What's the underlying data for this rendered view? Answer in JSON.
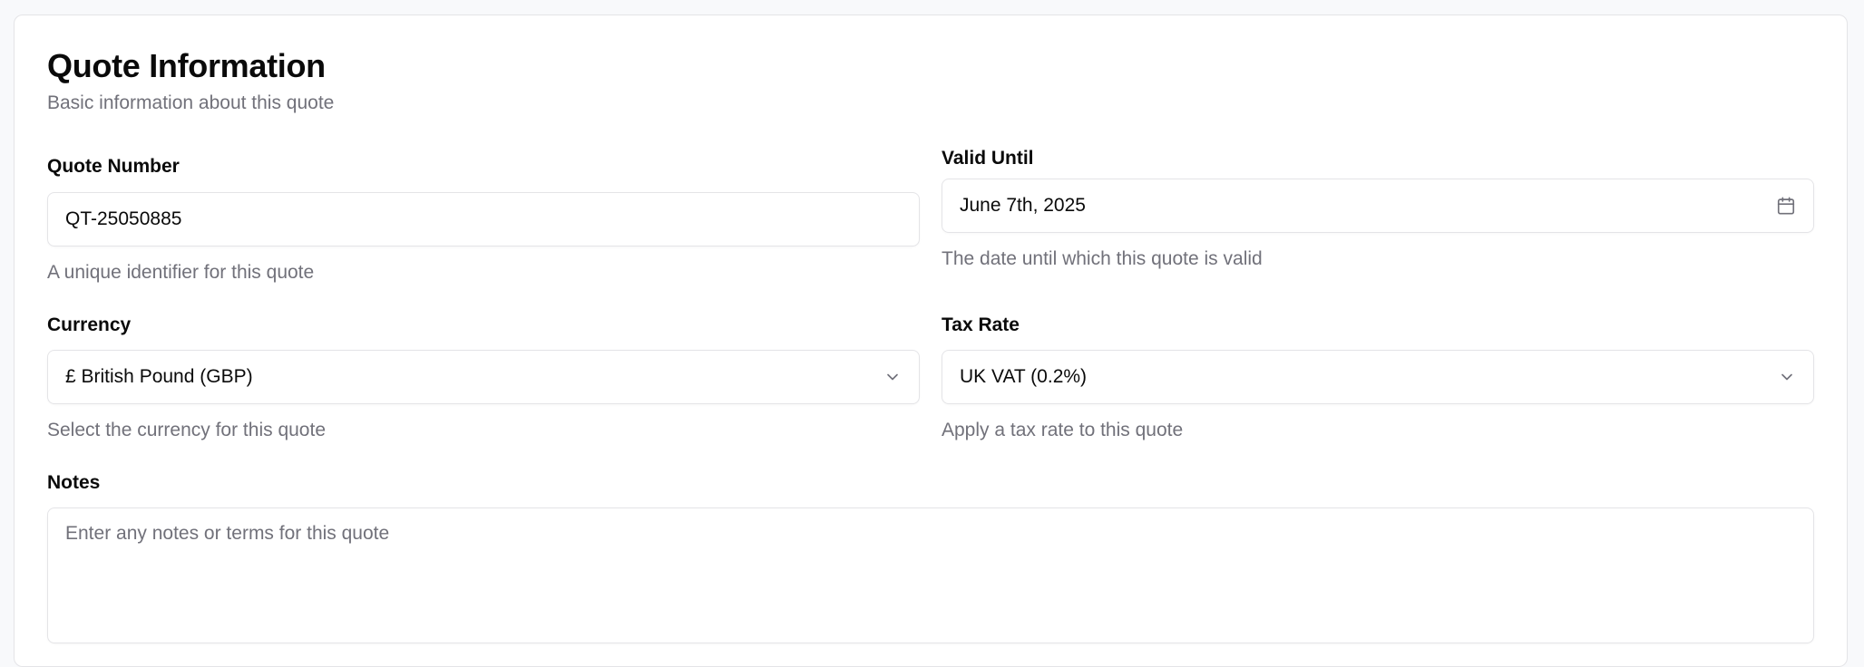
{
  "section": {
    "title": "Quote Information",
    "subtitle": "Basic information about this quote"
  },
  "quote_number": {
    "label": "Quote Number",
    "value": "QT-25050885",
    "hint": "A unique identifier for this quote"
  },
  "valid_until": {
    "label": "Valid Until",
    "value": "June 7th, 2025",
    "hint": "The date until which this quote is valid",
    "icon": "calendar-icon"
  },
  "currency": {
    "label": "Currency",
    "value": "£ British Pound (GBP)",
    "hint": "Select the currency for this quote",
    "icon": "chevron-down-icon"
  },
  "tax_rate": {
    "label": "Tax Rate",
    "value": "UK VAT (0.2%)",
    "hint": "Apply a tax rate to this quote",
    "icon": "chevron-down-icon"
  },
  "notes": {
    "label": "Notes",
    "placeholder": "Enter any notes or terms for this quote"
  },
  "colors": {
    "border": "#e4e4e7",
    "muted_text": "#71717a",
    "text": "#0a0a0a",
    "page_bg": "#f8f9fb"
  }
}
